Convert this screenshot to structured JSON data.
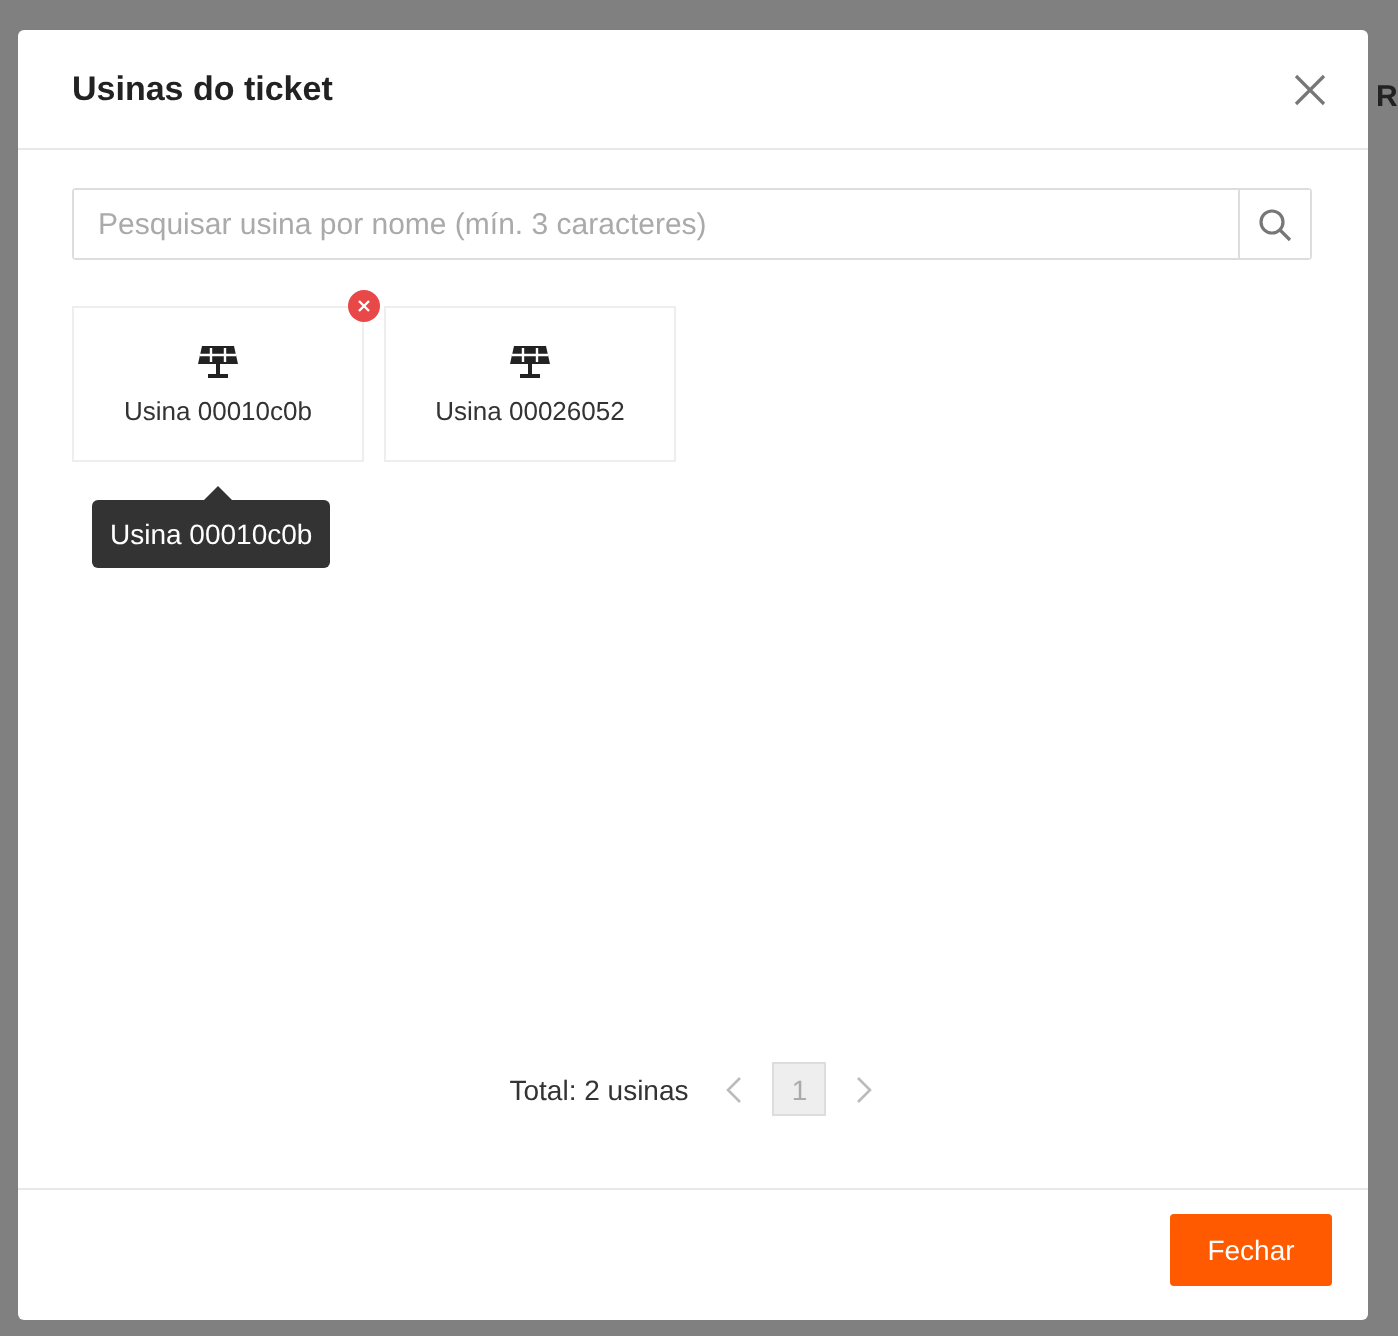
{
  "background": {
    "column_heading": "R"
  },
  "modal": {
    "title": "Usinas do ticket",
    "search": {
      "placeholder": "Pesquisar usina por nome (mín. 3 caracteres)"
    },
    "plants": [
      {
        "name": "Usina 00010c0b",
        "hovered": true
      },
      {
        "name": "Usina 00026052",
        "hovered": false
      }
    ],
    "tooltip": {
      "text": "Usina 00010c0b"
    },
    "pagination": {
      "total": "Total: 2 usinas",
      "pages": [
        {
          "label": "1",
          "selected": true
        }
      ]
    },
    "footer": {
      "button": "Fechar"
    }
  }
}
